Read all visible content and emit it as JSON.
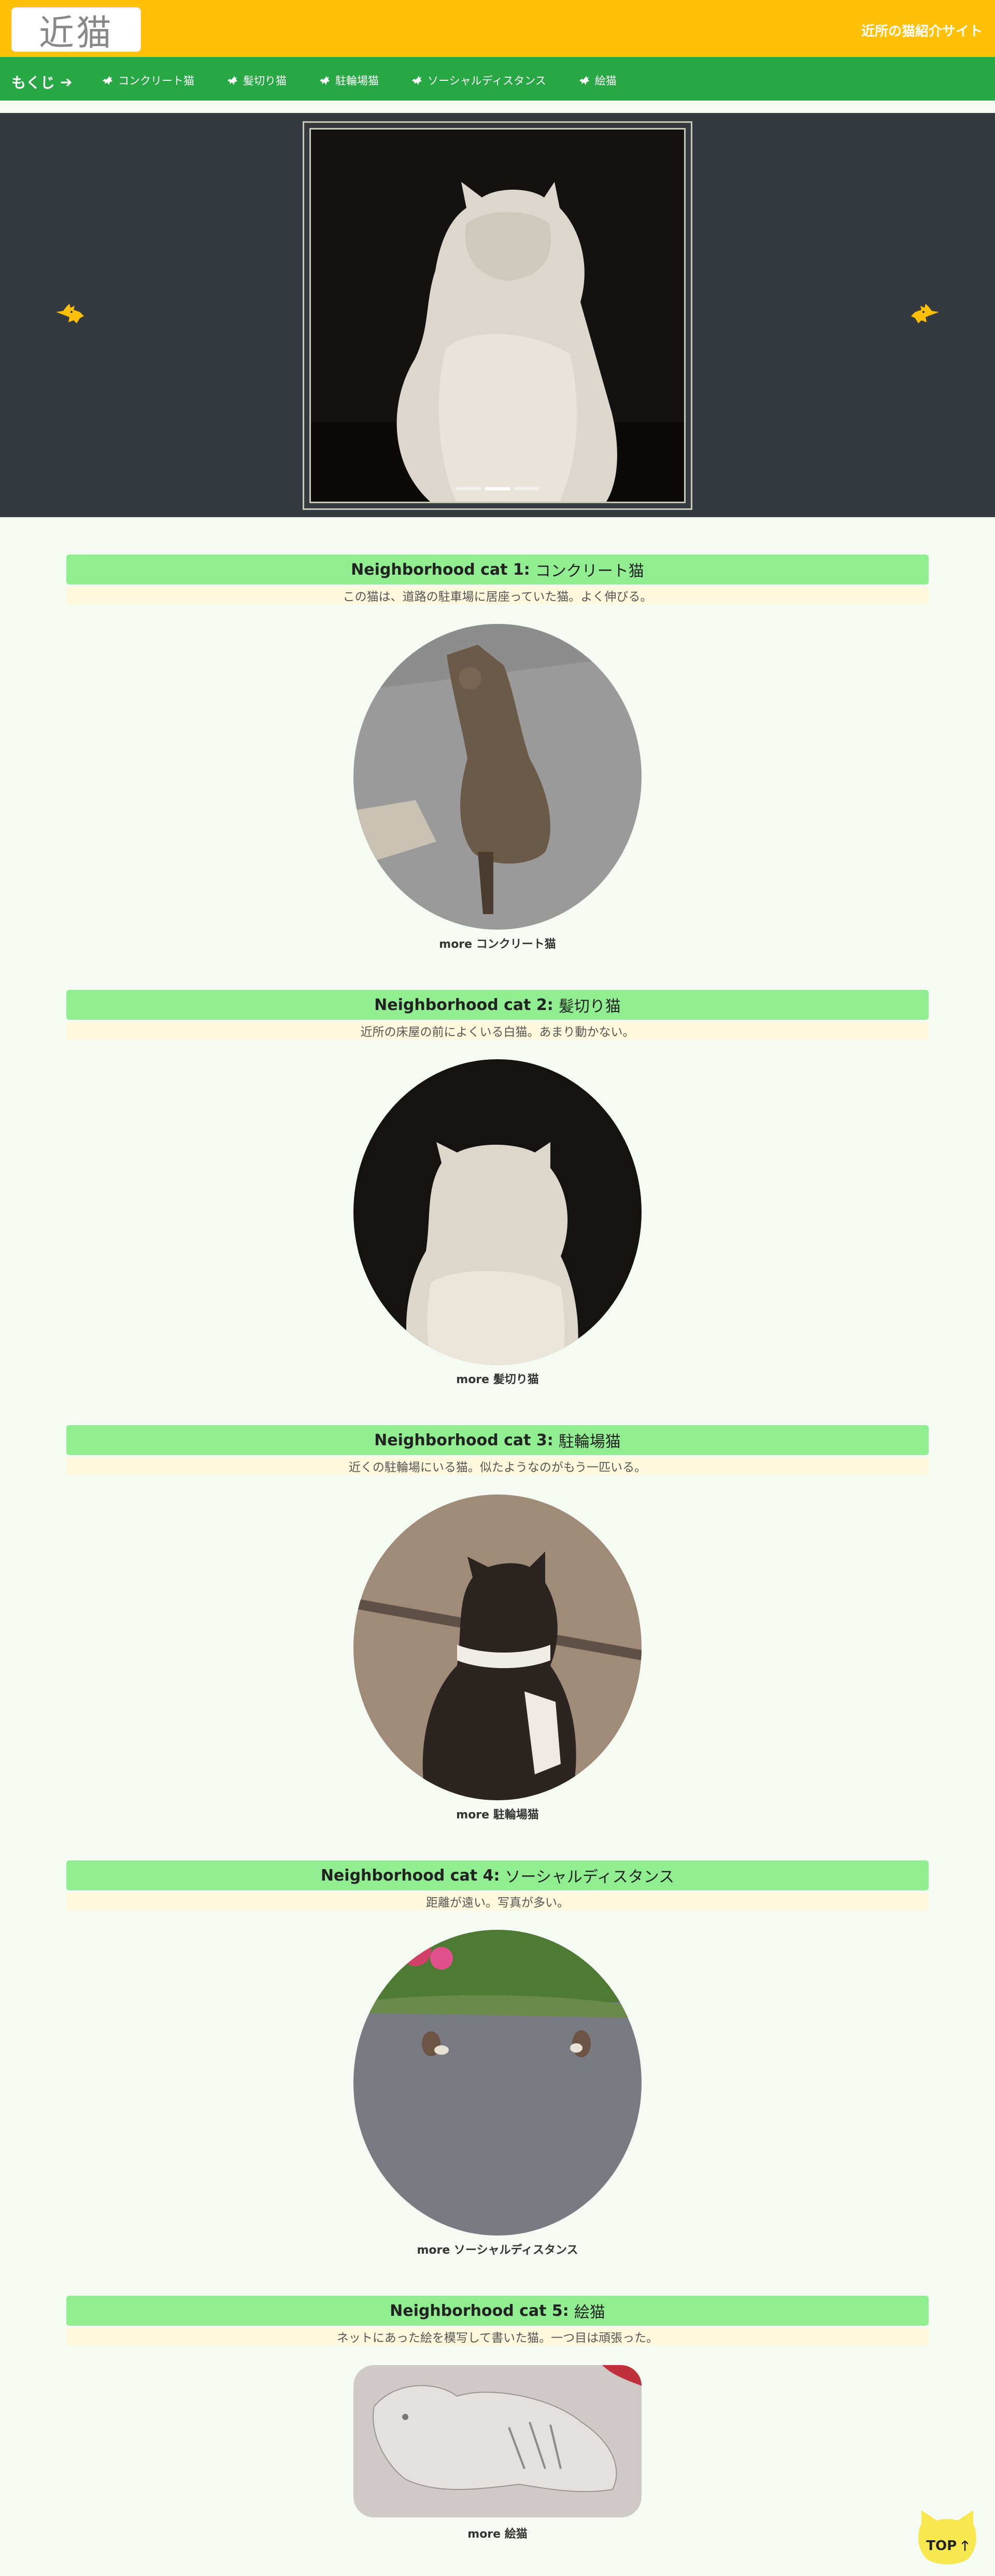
{
  "header": {
    "logo_text": "近猫",
    "site_title": "近所の猫紹介サイト"
  },
  "nav": {
    "toc_label": "もくじ",
    "toc_arrow": "➔",
    "items": [
      {
        "label": "コンクリート猫"
      },
      {
        "label": "髪切り猫"
      },
      {
        "label": "駐輪場猫"
      },
      {
        "label": "ソーシャルディスタンス"
      },
      {
        "label": "絵猫"
      }
    ]
  },
  "carousel": {
    "indicators": 3,
    "active_indicator": 2,
    "prev_icon": "pointing-cat-left-icon",
    "next_icon": "pointing-cat-right-icon"
  },
  "sections": [
    {
      "prefix": "Neighborhood cat 1:",
      "name": "コンクリート猫",
      "desc": "この猫は、道路の駐車場に居座っていた猫。よく伸びる。",
      "more": "more コンクリート猫"
    },
    {
      "prefix": "Neighborhood cat 2:",
      "name": "髪切り猫",
      "desc": "近所の床屋の前によくいる白猫。あまり動かない。",
      "more": "more 髪切り猫"
    },
    {
      "prefix": "Neighborhood cat 3:",
      "name": "駐輪場猫",
      "desc": "近くの駐輪場にいる猫。似たようなのがもう一匹いる。",
      "more": "more 駐輪場猫"
    },
    {
      "prefix": "Neighborhood cat 4:",
      "name": "ソーシャルディスタンス",
      "desc": "距離が遠い。写真が多い。",
      "more": "more ソーシャルディスタンス"
    },
    {
      "prefix": "Neighborhood cat 5:",
      "name": "絵猫",
      "desc": "ネットにあった絵を模写して書いた猫。一つ目は頑張った。",
      "more": "more 絵猫"
    }
  ],
  "top_button": {
    "label": "TOP",
    "arrow": "🡑"
  },
  "colors": {
    "header_bg": "#ffc107",
    "nav_bg": "#28a745",
    "carousel_bg": "#343a40",
    "section_title_bg": "#90ee90",
    "section_desc_bg": "#fff8dc",
    "page_bg": "#f5faf3"
  }
}
